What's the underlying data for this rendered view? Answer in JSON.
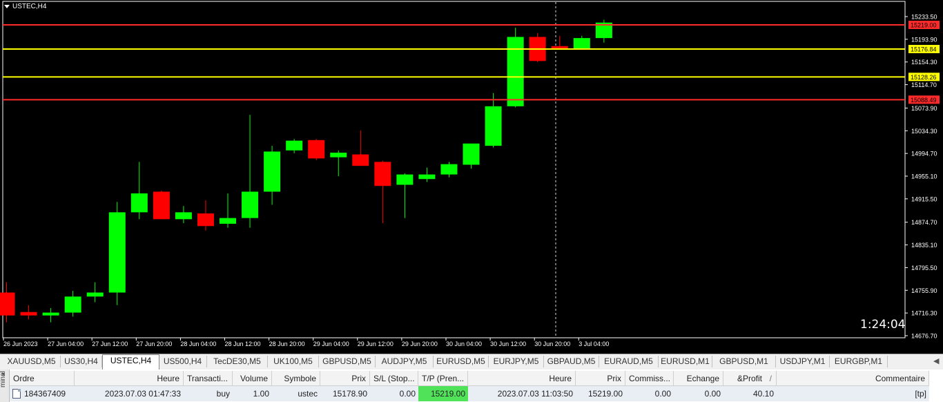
{
  "chart": {
    "title": "USTEC,H4",
    "timer": "1:24:04",
    "price_axis": [
      "15233.50",
      "15193.90",
      "15154.30",
      "15114.70",
      "15073.90",
      "15034.30",
      "14994.70",
      "14955.10",
      "14915.50",
      "14874.70",
      "14835.10",
      "14795.50",
      "14755.90",
      "14716.30",
      "14676.70"
    ],
    "time_axis": [
      "26 Jun 2023",
      "27 Jun 04:00",
      "27 Jun 12:00",
      "27 Jun 20:00",
      "28 Jun 04:00",
      "28 Jun 12:00",
      "28 Jun 20:00",
      "29 Jun 04:00",
      "29 Jun 12:00",
      "29 Jun 20:00",
      "30 Jun 04:00",
      "30 Jun 12:00",
      "30 Jun 20:00",
      "3 Jul 04:00"
    ],
    "price_min": 14676.7,
    "price_max": 15233.5,
    "levels": [
      {
        "price": 15219.0,
        "label": "15219.00",
        "color": "#ff2a2a"
      },
      {
        "price": 15176.84,
        "label": "15176.84",
        "color": "#ffff00"
      },
      {
        "price": 15128.26,
        "label": "15128.26",
        "color": "#ffff00"
      },
      {
        "price": 15088.49,
        "label": "15088.49",
        "color": "#ff2a2a"
      }
    ],
    "bull_color": "#00ff00",
    "bear_color": "#ff0000"
  },
  "chart_data": {
    "type": "candlestick",
    "series": [
      {
        "name": "USTEC,H4",
        "ohlc": [
          [
            14752,
            14770,
            14700,
            14712
          ],
          [
            14718,
            14730,
            14705,
            14712
          ],
          [
            14712,
            14725,
            14700,
            14717
          ],
          [
            14717,
            14755,
            14710,
            14745
          ],
          [
            14745,
            14770,
            14735,
            14752
          ],
          [
            14752,
            14910,
            14730,
            14892
          ],
          [
            14892,
            14980,
            14880,
            14925
          ],
          [
            14928,
            14930,
            14880,
            14880
          ],
          [
            14880,
            14903,
            14873,
            14892
          ],
          [
            14890,
            14913,
            14860,
            14868
          ],
          [
            14872,
            14925,
            14865,
            14882
          ],
          [
            14882,
            15062,
            14865,
            14928
          ],
          [
            14928,
            15008,
            14905,
            14998
          ],
          [
            15000,
            15020,
            14995,
            15017
          ],
          [
            15018,
            15020,
            14983,
            14986
          ],
          [
            14988,
            15000,
            14955,
            14996
          ],
          [
            14993,
            15035,
            14975,
            14973
          ],
          [
            14980,
            14982,
            14873,
            14938
          ],
          [
            14940,
            14960,
            14882,
            14958
          ],
          [
            14950,
            14970,
            14945,
            14958
          ],
          [
            14958,
            14980,
            14953,
            14976
          ],
          [
            14975,
            15011,
            14968,
            15012
          ],
          [
            15008,
            15100,
            15005,
            15077
          ],
          [
            15077,
            15214,
            15075,
            15198
          ],
          [
            15198,
            15205,
            15154,
            15156
          ],
          [
            15182,
            15200,
            15176,
            15178
          ],
          [
            15178,
            15200,
            15176,
            15196
          ],
          [
            15196,
            15228,
            15188,
            15223
          ]
        ]
      }
    ],
    "ylim": [
      14676.7,
      15233.5
    ]
  },
  "tabs": [
    "XAUUSD,M5",
    "US30,H4",
    "USTEC,H4",
    "US500,H4",
    "TecDE30,M5",
    "UK100,M5",
    "GBPUSD,M5",
    "AUDJPY,M5",
    "EURUSD,M5",
    "EURJPY,M5",
    "GBPAUD,M5",
    "EURAUD,M5",
    "EURUSD,M1",
    "GBPUSD,M1",
    "USDJPY,M1",
    "EURGBP,M1"
  ],
  "active_tab": "USTEC,H4",
  "terminal": {
    "side_label": "minal",
    "close": "×",
    "headers": {
      "ordre": "Ordre",
      "heure": "Heure",
      "transaction": "Transacti...",
      "volume": "Volume",
      "symbole": "Symbole",
      "prix": "Prix",
      "sl": "S/L (Stop...",
      "tp": "T/P (Pren...",
      "heure2": "Heure",
      "prix2": "Prix",
      "commission": "Commiss...",
      "echange": "Echange",
      "profit": "&Profit",
      "sort": "/",
      "commentaire": "Commentaire"
    },
    "row": {
      "ordre": "184367409",
      "heure": "2023.07.03 01:47:33",
      "transaction": "buy",
      "volume": "1.00",
      "symbole": "ustec",
      "prix": "15178.90",
      "sl": "0.00",
      "tp": "15219.00",
      "heure2": "2023.07.03 11:03:50",
      "prix2": "15219.00",
      "commission": "0.00",
      "echange": "0.00",
      "profit": "40.10",
      "commentaire": "[tp]"
    }
  }
}
